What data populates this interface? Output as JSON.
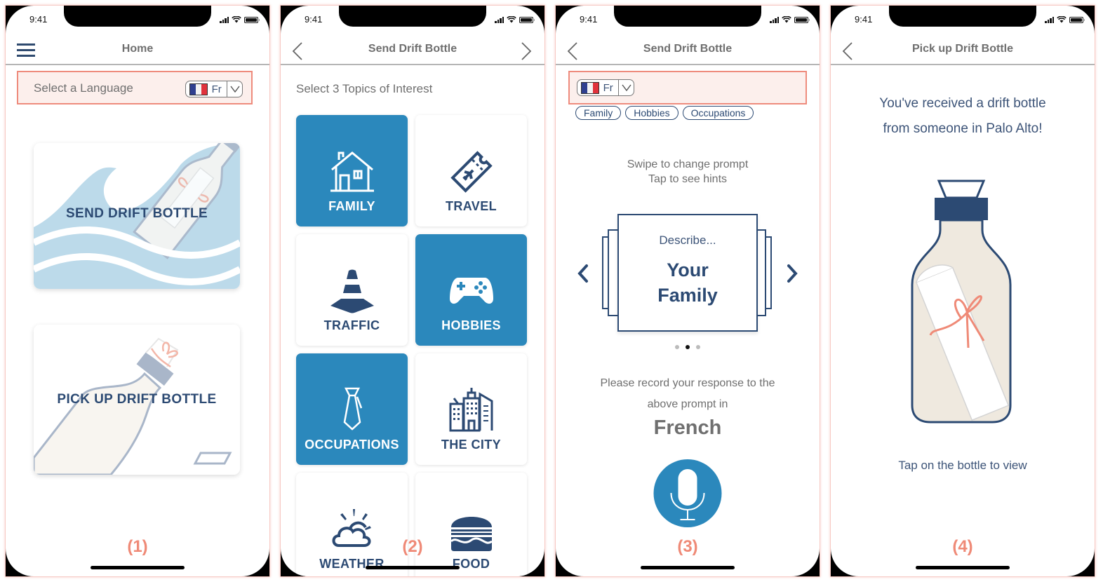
{
  "status_bar": {
    "time": "9:41"
  },
  "colors": {
    "accent": "#2b88bc",
    "navy": "#2c4a73",
    "highlight_border": "#ee8b7c",
    "highlight_bg": "#fcefec",
    "screen_number": "#ef8a77",
    "flag_blue": "#2f3f8f",
    "flag_white": "#f3f3f3",
    "flag_red": "#e0323c"
  },
  "screens": [
    {
      "number_label": "(1)",
      "nav": {
        "title": "Home",
        "left_icon": "hamburger-menu-icon"
      },
      "language": {
        "label": "Select a Language",
        "code": "Fr",
        "flag": "france-flag-icon",
        "dropdown_icon": "chevron-down-icon"
      },
      "cards": [
        {
          "label": "SEND DRIFT BOTTLE",
          "illustration": "waves-bottle-illustration"
        },
        {
          "label": "PICK UP DRIFT BOTTLE",
          "illustration": "tilted-bottle-illustration"
        }
      ]
    },
    {
      "number_label": "(2)",
      "nav": {
        "title": "Send Drift Bottle",
        "left_icon": "chevron-left-icon",
        "right_icon": "chevron-right-icon"
      },
      "subheading": "Select 3 Topics of Interest",
      "topics": [
        {
          "label": "FAMILY",
          "icon": "house-icon",
          "selected": true
        },
        {
          "label": "TRAVEL",
          "icon": "plane-ticket-icon",
          "selected": false
        },
        {
          "label": "TRAFFIC",
          "icon": "traffic-cone-icon",
          "selected": false
        },
        {
          "label": "HOBBIES",
          "icon": "gamepad-icon",
          "selected": true
        },
        {
          "label": "OCCUPATIONS",
          "icon": "necktie-icon",
          "selected": true
        },
        {
          "label": "THE CITY",
          "icon": "city-buildings-icon",
          "selected": false
        },
        {
          "label": "WEATHER",
          "icon": "sun-cloud-icon",
          "selected": false
        },
        {
          "label": "FOOD",
          "icon": "burger-icon",
          "selected": false
        }
      ]
    },
    {
      "number_label": "(3)",
      "nav": {
        "title": "Send Drift Bottle",
        "left_icon": "chevron-left-icon"
      },
      "language": {
        "code": "Fr",
        "flag": "france-flag-icon",
        "dropdown_icon": "chevron-down-icon"
      },
      "tags": [
        "Family",
        "Hobbies",
        "Occupations"
      ],
      "hint_line1": "Swipe to change prompt",
      "hint_line2": "Tap to see hints",
      "prompt": {
        "describe": "Describe...",
        "topic_line1": "Your",
        "topic_line2": "Family"
      },
      "pagination": {
        "total": 3,
        "active_index": 1
      },
      "record_line1": "Please record your response to the",
      "record_line2": "above prompt in",
      "record_language": "French",
      "mic_icon": "microphone-icon"
    },
    {
      "number_label": "(4)",
      "nav": {
        "title": "Pick up Drift Bottle",
        "left_icon": "chevron-left-icon"
      },
      "received_line1": "You've received a drift bottle",
      "received_line2": "from someone in Palo Alto!",
      "bottle_icon": "message-bottle-icon",
      "tap_text": "Tap on the bottle to view"
    }
  ]
}
